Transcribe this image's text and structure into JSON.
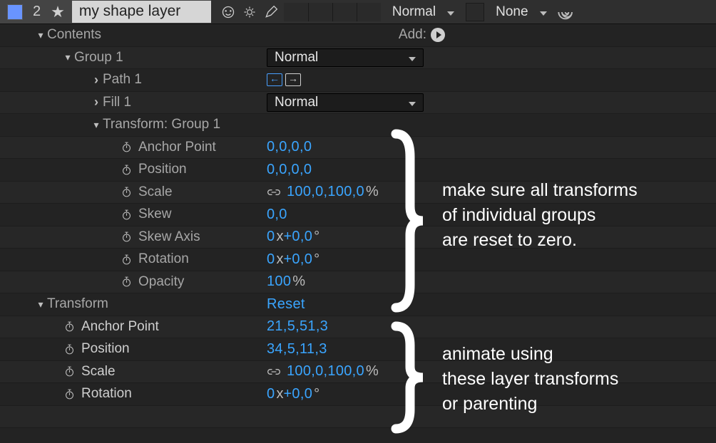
{
  "header": {
    "layer_index": "2",
    "layer_name": "my shape layer",
    "blend_mode": "Normal",
    "parent": "None"
  },
  "contents": {
    "label": "Contents",
    "add_label": "Add:"
  },
  "group1": {
    "label": "Group 1",
    "blend_mode": "Normal",
    "path_label": "Path 1",
    "fill_label": "Fill 1",
    "fill_blend": "Normal",
    "transform_label": "Transform: Group 1",
    "props": {
      "anchor_point": {
        "label": "Anchor Point",
        "value": "0,0,0,0"
      },
      "position": {
        "label": "Position",
        "value": "0,0,0,0"
      },
      "scale": {
        "label": "Scale",
        "value": "100,0,100,0",
        "unit": "%"
      },
      "skew": {
        "label": "Skew",
        "value": "0,0"
      },
      "skew_axis": {
        "label": "Skew Axis",
        "prefix": "0",
        "prefix_unit": "x",
        "value": "+0,0",
        "unit": "°"
      },
      "rotation": {
        "label": "Rotation",
        "prefix": "0",
        "prefix_unit": "x",
        "value": "+0,0",
        "unit": "°"
      },
      "opacity": {
        "label": "Opacity",
        "value": "100",
        "unit": "%"
      }
    }
  },
  "transform": {
    "label": "Transform",
    "reset_label": "Reset",
    "props": {
      "anchor_point": {
        "label": "Anchor Point",
        "value": "21,5,51,3"
      },
      "position": {
        "label": "Position",
        "value": "34,5,11,3"
      },
      "scale": {
        "label": "Scale",
        "value": "100,0,100,0",
        "unit": "%"
      },
      "rotation": {
        "label": "Rotation",
        "prefix": "0",
        "prefix_unit": "x",
        "value": "+0,0",
        "unit": "°"
      }
    }
  },
  "annotations": {
    "top": "make sure all transforms\nof individual groups\nare reset to zero.",
    "bottom": "animate using\nthese layer transforms\nor parenting"
  }
}
